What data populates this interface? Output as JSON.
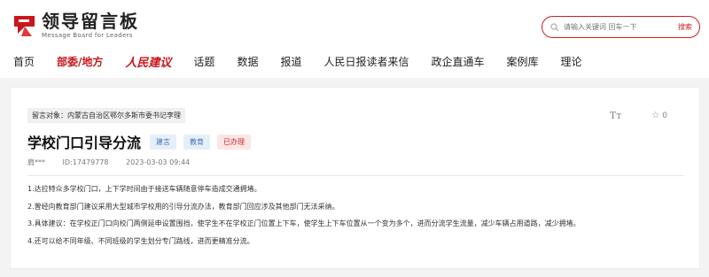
{
  "header": {
    "logo_title": "领导留言板",
    "logo_subtitle": "Message Board for Leaders",
    "search": {
      "placeholder": "请输入关键词 回车一下",
      "button_label": "搜索"
    }
  },
  "nav": {
    "items": [
      {
        "label": "首页"
      },
      {
        "label": "部委/地方"
      },
      {
        "label": "人民建议"
      },
      {
        "label": "话题"
      },
      {
        "label": "数据"
      },
      {
        "label": "报道"
      },
      {
        "label": "人民日报读者来信"
      },
      {
        "label": "政企直通车"
      },
      {
        "label": "案例库"
      },
      {
        "label": "理论"
      }
    ]
  },
  "message": {
    "recipient": "留言对象：内蒙古自治区鄂尔多斯市委书记李理",
    "font_tool": "Tт",
    "star_count": "0",
    "title": "学校门口引导分流",
    "tags": [
      "建言",
      "教育",
      "已办理"
    ],
    "author": "肩***",
    "id": "ID:17479778",
    "date": "2023-03-03 09:44",
    "paragraphs": [
      "1.达拉特众多学校门口，上下学时间由于接送车辆随意停车造成交通拥堵。",
      "2.曾经向教育部门建议采用大型城市学校用的引导分流办法，教育部门回应涉及其他部门无法采纳。",
      "3.具体建议：在学校正门口向校门两侧延申设置围挡，使学生不在学校正门位置上下车，使学生上下车位置从一个变为多个，进而分流学生流量，减少车辆占用道路，减少拥堵。",
      "4.还可以给不同年级、不同班级的学生划分专门路线，进而更精准分流。"
    ]
  },
  "colors": {
    "brand_red": "#c8161d",
    "tag_blue": "#3d73b8",
    "tag_red": "#cc2b2b"
  }
}
